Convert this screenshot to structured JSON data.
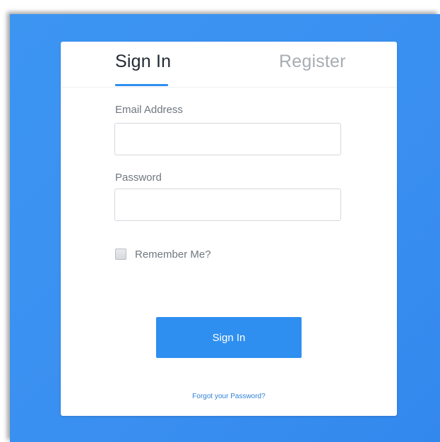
{
  "colors": {
    "background_blue": "#3a8ff0",
    "accent": "#2f8ff0",
    "link": "#2f7fd6",
    "active_tab_text": "#222a33",
    "inactive_tab_text": "#a8adb3",
    "label_text": "#6f7780"
  },
  "tabs": {
    "signin_label": "Sign In",
    "register_label": "Register",
    "active": "Sign In"
  },
  "form": {
    "email_label": "Email Address",
    "email_value": "",
    "email_placeholder": "",
    "password_label": "Password",
    "password_value": "",
    "password_placeholder": "",
    "remember_label": "Remember Me?",
    "remember_checked": false
  },
  "actions": {
    "signin_button_label": "Sign In",
    "forgot_link": "Forgot your Password?"
  },
  "icons": {
    "remember_checkbox": "checkbox-unchecked-icon"
  }
}
